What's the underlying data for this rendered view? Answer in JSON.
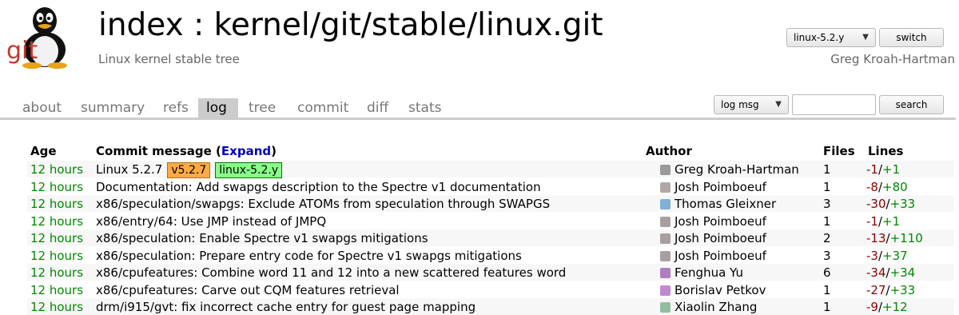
{
  "header": {
    "title": "index : kernel/git/stable/linux.git",
    "description": "Linux kernel stable tree",
    "owner": "Greg Kroah-Hartman",
    "logo_text": "git",
    "branch_select": "linux-5.2.y",
    "switch_label": "switch"
  },
  "tabs": [
    "about",
    "summary",
    "refs",
    "log",
    "tree",
    "commit",
    "diff",
    "stats"
  ],
  "active_tab": "log",
  "search": {
    "mode": "log msg",
    "value": "",
    "button_label": "search"
  },
  "table": {
    "headers": {
      "age": "Age",
      "message": "Commit message",
      "expand_open": "(",
      "expand": "Expand",
      "expand_close": ")",
      "author": "Author",
      "files": "Files",
      "lines": "Lines"
    },
    "rows": [
      {
        "age": "12 hours",
        "message": "Linux 5.2.7",
        "tag": "v5.2.7",
        "branch": "linux-5.2.y",
        "author": "Greg Kroah-Hartman",
        "files": "1",
        "del": "-1",
        "add": "+1"
      },
      {
        "age": "12 hours",
        "message": "Documentation: Add swapgs description to the Spectre v1 documentation",
        "author": "Josh Poimboeuf",
        "files": "1",
        "del": "-8",
        "add": "+80"
      },
      {
        "age": "12 hours",
        "message": "x86/speculation/swapgs: Exclude ATOMs from speculation through SWAPGS",
        "author": "Thomas Gleixner",
        "files": "3",
        "del": "-30",
        "add": "+33"
      },
      {
        "age": "12 hours",
        "message": "x86/entry/64: Use JMP instead of JMPQ",
        "author": "Josh Poimboeuf",
        "files": "1",
        "del": "-1",
        "add": "+1"
      },
      {
        "age": "12 hours",
        "message": "x86/speculation: Enable Spectre v1 swapgs mitigations",
        "author": "Josh Poimboeuf",
        "files": "2",
        "del": "-13",
        "add": "+110"
      },
      {
        "age": "12 hours",
        "message": "x86/speculation: Prepare entry code for Spectre v1 swapgs mitigations",
        "author": "Josh Poimboeuf",
        "files": "3",
        "del": "-3",
        "add": "+37"
      },
      {
        "age": "12 hours",
        "message": "x86/cpufeatures: Combine word 11 and 12 into a new scattered features word",
        "author": "Fenghua Yu",
        "files": "6",
        "del": "-34",
        "add": "+34"
      },
      {
        "age": "12 hours",
        "message": "x86/cpufeatures: Carve out CQM features retrieval",
        "author": "Borislav Petkov",
        "files": "1",
        "del": "-27",
        "add": "+33"
      },
      {
        "age": "12 hours",
        "message": "drm/i915/gvt: fix incorrect cache entry for guest page mapping",
        "author": "Xiaolin Zhang",
        "files": "1",
        "del": "-9",
        "add": "+12"
      }
    ]
  },
  "colors": {
    "age": "#008800",
    "link": "#0000bb",
    "deletions": "#880000",
    "additions": "#008800",
    "tag_badge": "#ffaa44",
    "branch_badge": "#88ff88",
    "tab_active_bg": "#cccccc"
  }
}
